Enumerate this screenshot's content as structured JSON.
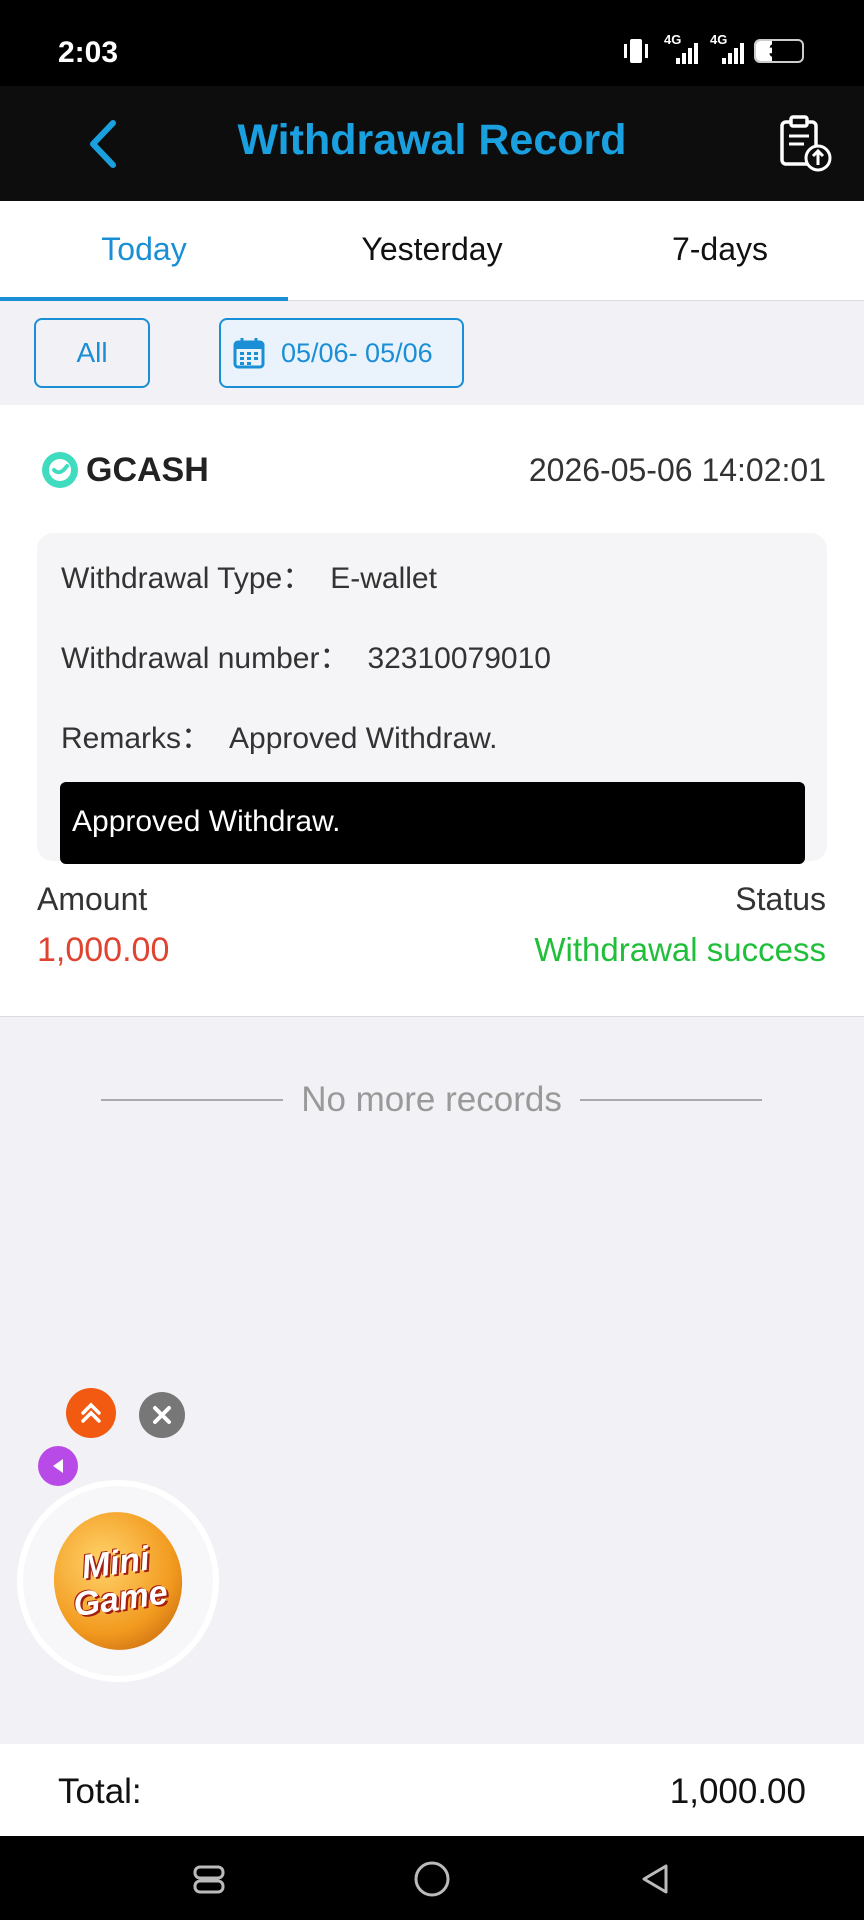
{
  "status_bar": {
    "time": "2:03",
    "net1": "4G",
    "net2": "4G",
    "battery": "34",
    "battery_level": 0.34
  },
  "header": {
    "title": "Withdrawal Record"
  },
  "tabs": [
    {
      "label": "Today",
      "active": true
    },
    {
      "label": "Yesterday",
      "active": false
    },
    {
      "label": "7-days",
      "active": false
    }
  ],
  "filters": {
    "all_label": "All",
    "date_range": "05/06- 05/06"
  },
  "record": {
    "method": "GCASH",
    "datetime": "2026-05-06 14:02:01",
    "type_label": "Withdrawal Type：",
    "type_value": "E-wallet",
    "number_label": "Withdrawal number：",
    "number_value": "32310079010",
    "remarks_label": "Remarks：",
    "remarks_value": "Approved Withdraw.",
    "tooltip": "Approved Withdraw.",
    "amount_label": "Amount",
    "amount_value": "1,000.00",
    "status_label": "Status",
    "status_value": "Withdrawal success"
  },
  "list_end": "No more records",
  "mini_game": {
    "line1": "Mini",
    "line2": "Game"
  },
  "total": {
    "label": "Total:",
    "value": "1,000.00"
  },
  "colors": {
    "accent": "#1a8fd6",
    "amount": "#e0432f",
    "success": "#1fbf3a"
  }
}
